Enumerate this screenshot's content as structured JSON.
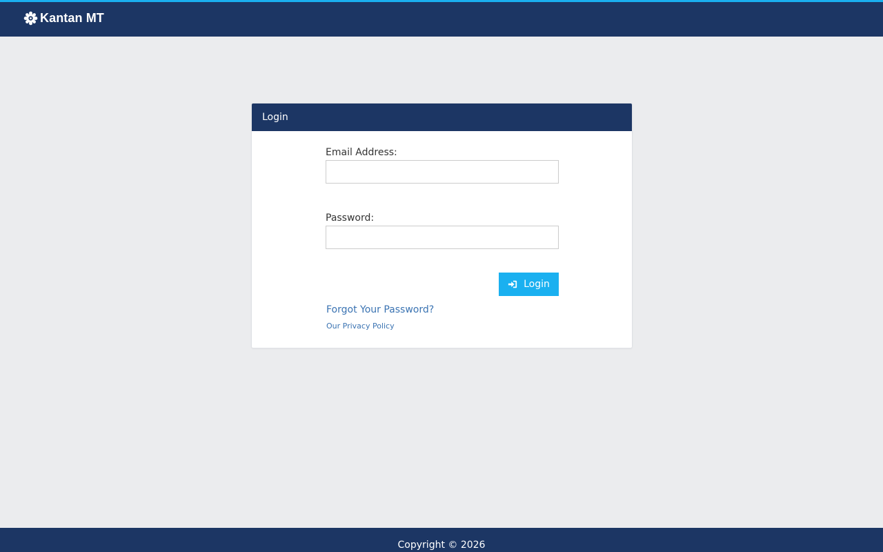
{
  "header": {
    "brand_name": "Kantan MT",
    "brand_icon": "gear-logo-icon",
    "accent_color": "#1ab0f0",
    "bar_color": "#1c3664"
  },
  "login_card": {
    "title": "Login",
    "email_label": "Email Address:",
    "email_value": "",
    "password_label": "Password:",
    "password_value": "",
    "login_button_label": "Login",
    "login_button_icon": "sign-in-icon",
    "forgot_password_link": "Forgot Your Password?",
    "privacy_policy_link": "Our Privacy Policy"
  },
  "footer": {
    "copyright": "Copyright © 2026"
  }
}
